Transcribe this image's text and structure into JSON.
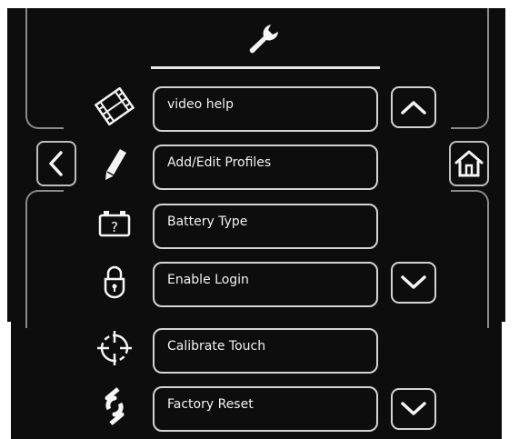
{
  "header": {
    "icon": "wrench-icon"
  },
  "nav": {
    "back_icon": "chevron-left-icon",
    "home_icon": "home-icon"
  },
  "menu": {
    "items": [
      {
        "label": "video help",
        "icon": "film-icon"
      },
      {
        "label": "Add/Edit Profiles",
        "icon": "pencil-icon"
      },
      {
        "label": "Battery Type",
        "icon": "battery-question-icon"
      },
      {
        "label": "Enable Login",
        "icon": "padlock-icon"
      },
      {
        "label": "Calibrate Touch",
        "icon": "crosshair-icon"
      },
      {
        "label": "Factory Reset",
        "icon": "reset-arrows-icon"
      }
    ]
  },
  "scroll": {
    "up_icon": "chevron-up-icon",
    "down_icon": "chevron-down-icon"
  },
  "colors": {
    "background": "#0d0d0d",
    "border": "#d4d4d4",
    "text": "#f2f2f2"
  }
}
